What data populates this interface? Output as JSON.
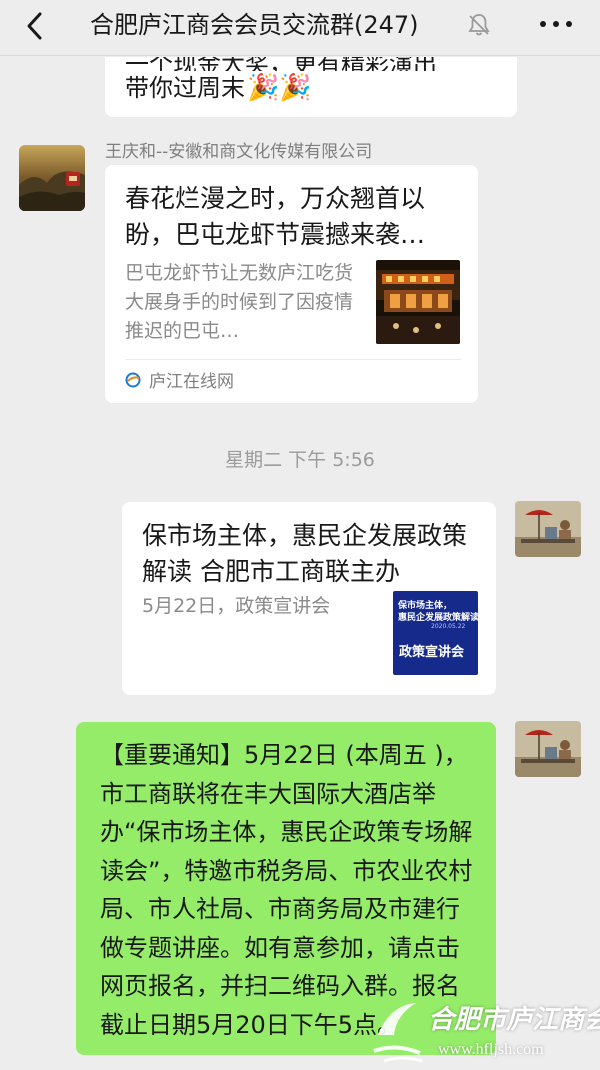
{
  "header": {
    "title": "合肥庐江商会会员交流群(247)",
    "back_icon": "chevron-left-icon",
    "mute_icon": "bell-off-icon",
    "more_icon": "more-icon"
  },
  "messages": {
    "top_partial": {
      "line1": "一个现金大奖，更有精彩演出",
      "line2": "带你过周末",
      "emoji": "🎉🎉"
    },
    "article1": {
      "sender": "王庆和--安徽和商文化传媒有限公司",
      "title": "春花烂漫之时，万众翘首以盼，巴屯龙虾节震撼来袭…",
      "desc": "巴屯龙虾节让无数庐江吃货大展身手的时候到了因疫情推迟的巴屯…",
      "source": "庐江在线网"
    },
    "time_separator": "星期二 下午 5:56",
    "article2": {
      "title": "保市场主体，惠民企发展政策解读  合肥市工商联主办",
      "desc": "5月22日，政策宣讲会",
      "thumb_line1": "保市场主体，",
      "thumb_line2": "惠民企发展政策解读",
      "thumb_date": "2020.05.22",
      "thumb_main": "政策宣讲会"
    },
    "notice": {
      "text": "【重要通知】5月22日 (本周五 )，市工商联将在丰大国际大酒店举办“保市场主体，惠民企政策专场解读会”，特邀市税务局、市农业农村局、市人社局、市商务局及市建行做专题讲座。如有意参加，请点击网页报名，并扫二维码入群。报名截止日期5月20日下午5点。"
    }
  },
  "watermark": {
    "text": "合肥市庐江商会",
    "url": "www.hfljsh.com"
  }
}
